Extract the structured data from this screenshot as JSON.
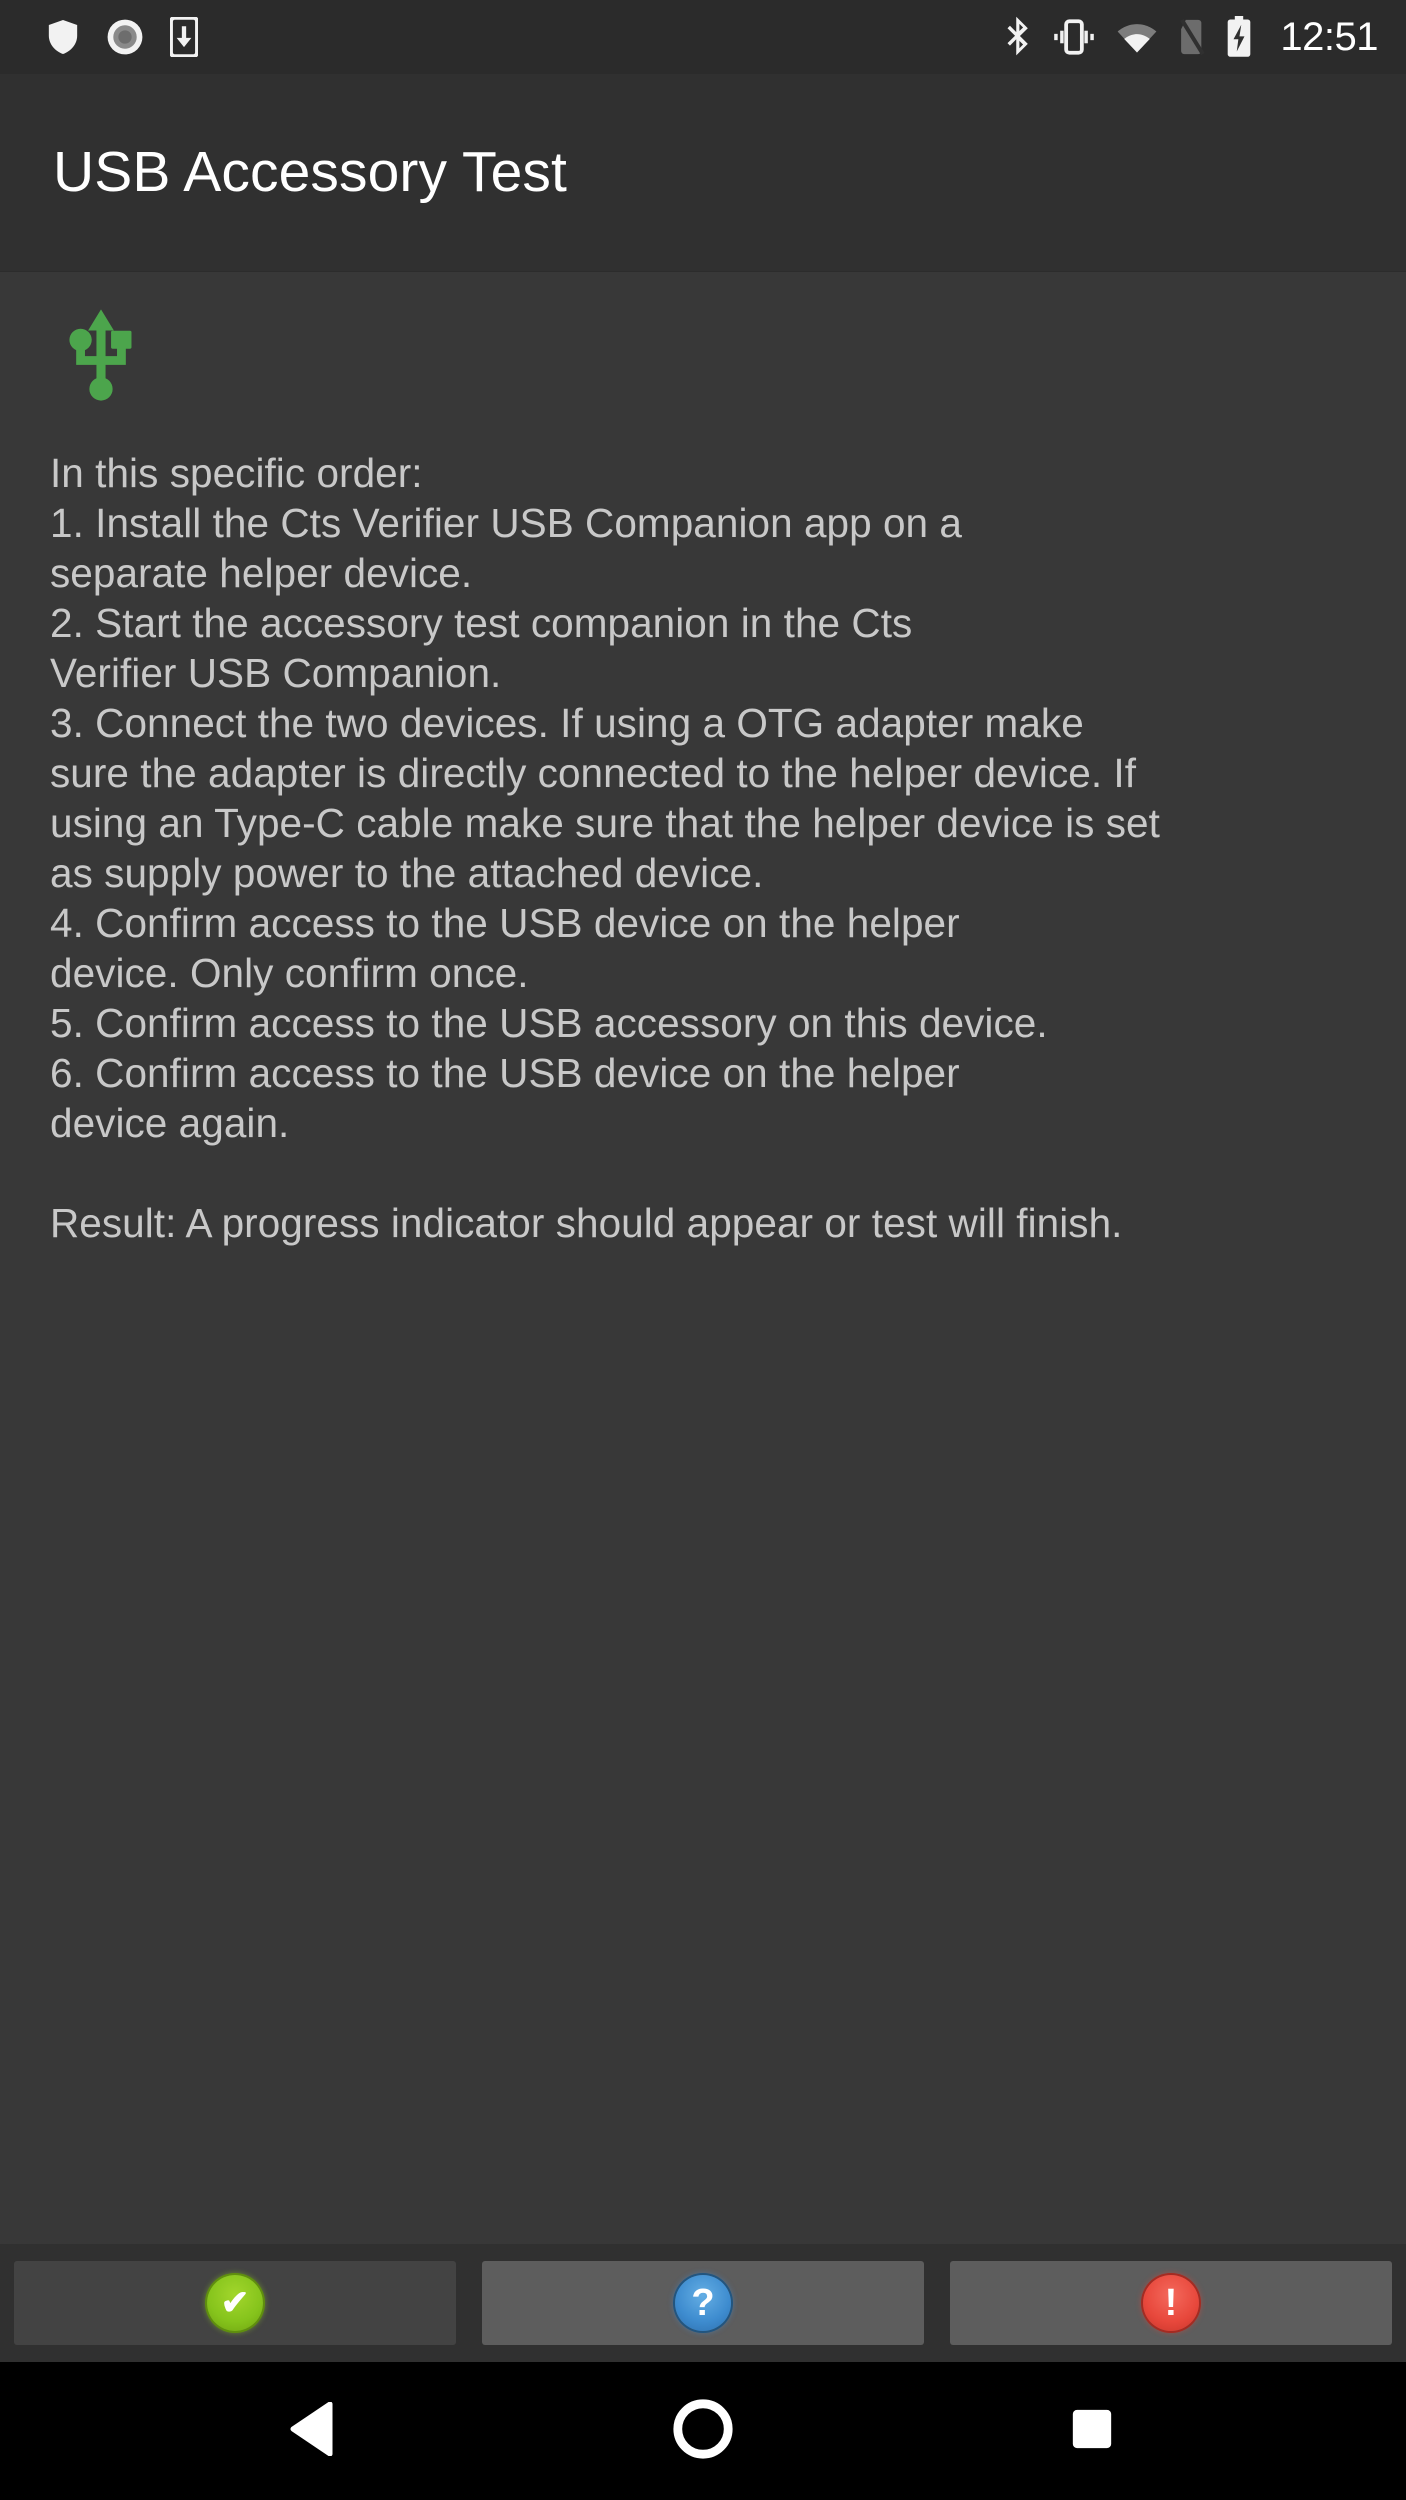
{
  "status_bar": {
    "left_icons": [
      {
        "name": "shield-icon",
        "label": "shield"
      },
      {
        "name": "screen-record-icon",
        "label": "screen record"
      },
      {
        "name": "download-to-device-icon",
        "label": "download"
      }
    ],
    "right_icons": [
      {
        "name": "bluetooth-icon",
        "label": "bluetooth"
      },
      {
        "name": "vibrate-mode-icon",
        "label": "vibrate"
      },
      {
        "name": "wifi-icon",
        "label": "wifi"
      },
      {
        "name": "no-sim-icon",
        "label": "no sim"
      },
      {
        "name": "battery-charging-icon",
        "label": "battery charging"
      }
    ],
    "time": "12:51"
  },
  "app_bar": {
    "title": "USB Accessory Test"
  },
  "content": {
    "usb_icon_name": "usb-icon",
    "usb_icon_color": "#4ca54c",
    "instructions": "In this specific order:\n1. Install the Cts Verifier USB Companion app on a\nseparate helper device.\n2. Start the accessory test companion in the Cts\nVerifier USB Companion.\n3. Connect the two devices. If using a OTG adapter make\nsure the adapter is directly connected to the helper device. If\nusing an Type-C cable make sure that the helper device is set\nas supply power to the attached device.\n4. Confirm access to the USB device on the helper\ndevice. Only confirm once.\n5. Confirm access to the USB accessory on this device.\n6. Confirm access to the USB device on the helper\ndevice again.\n\nResult: A progress indicator should appear or test will finish."
  },
  "buttons": [
    {
      "name": "pass-button",
      "icon": "check-circle-icon",
      "glyph": "✔",
      "color": "#86c41c"
    },
    {
      "name": "info-button",
      "icon": "question-circle-icon",
      "glyph": "?",
      "color": "#3e8ccf"
    },
    {
      "name": "fail-button",
      "icon": "exclamation-circle-icon",
      "glyph": "!",
      "color": "#e8483c"
    }
  ],
  "nav_bar": [
    {
      "name": "nav-back-button",
      "icon": "triangle-back-icon"
    },
    {
      "name": "nav-home-button",
      "icon": "circle-home-icon"
    },
    {
      "name": "nav-recents-button",
      "icon": "square-recents-icon"
    }
  ]
}
